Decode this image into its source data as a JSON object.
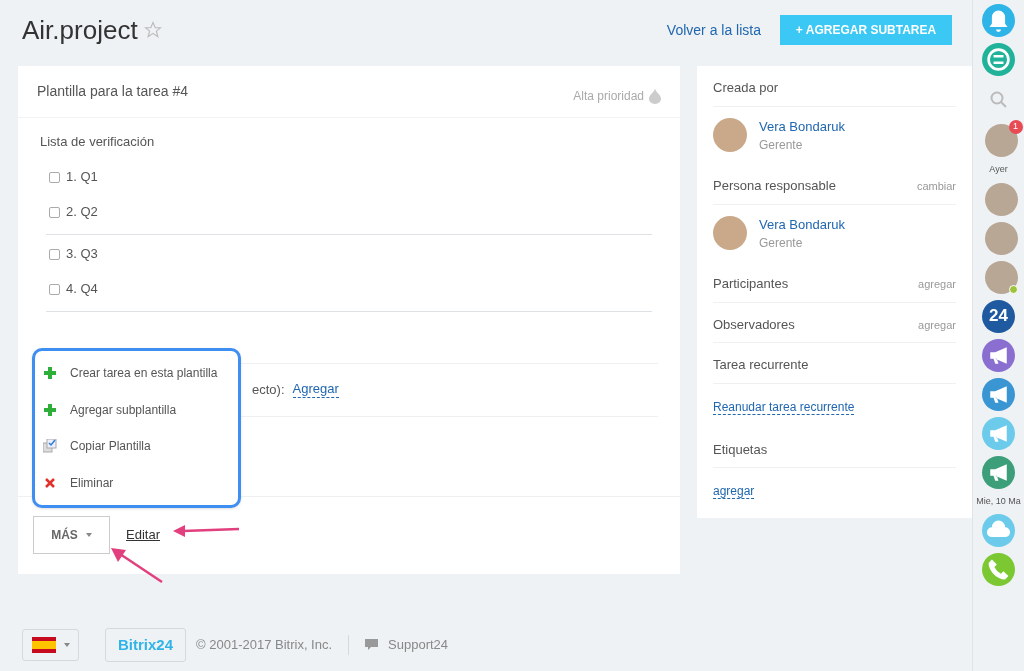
{
  "header": {
    "title": "Air.project",
    "starred": false,
    "back_link": "Volver a la lista",
    "add_button": "+ AGREGAR SUBTAREA"
  },
  "task": {
    "title": "Plantilla para la tarea #4",
    "priority": "Alta prioridad",
    "checklist_title": "Lista de verificación",
    "groups": [
      [
        {
          "label": "1. Q1",
          "checked": false
        },
        {
          "label": "2. Q2",
          "checked": false
        }
      ],
      [
        {
          "label": "3. Q3",
          "checked": false
        },
        {
          "label": "4. Q4",
          "checked": false
        }
      ]
    ],
    "project_row": {
      "label": "ecto):",
      "link": "Agregar"
    },
    "more_button": "MÁS",
    "edit_link": "Editar"
  },
  "menu": [
    {
      "kind": "plus",
      "label": "Crear tarea en esta plantilla"
    },
    {
      "kind": "plus",
      "label": "Agregar subplantilla"
    },
    {
      "kind": "copy",
      "label": "Copiar Plantilla"
    },
    {
      "kind": "delete",
      "label": "Eliminar"
    }
  ],
  "side": {
    "created_by": "Creada por",
    "creator": {
      "name": "Vera Bondaruk",
      "role": "Gerente"
    },
    "responsible": "Persona responsable",
    "change": "cambiar",
    "responsible_person": {
      "name": "Vera Bondaruk",
      "role": "Gerente"
    },
    "participants": "Participantes",
    "participants_add": "agregar",
    "observers": "Observadores",
    "observers_add": "agregar",
    "recurring": "Tarea recurrente",
    "recurring_link": "Reanudar tarea recurrente",
    "tags": "Etiquetas",
    "tags_add": "agregar"
  },
  "rail": [
    {
      "kind": "bell",
      "color": "#2fb4e8"
    },
    {
      "kind": "chat",
      "color": "#21b39a"
    },
    {
      "kind": "search"
    },
    {
      "kind": "avatar",
      "badge": "1"
    },
    {
      "kind": "label",
      "text": "Ayer"
    },
    {
      "kind": "avatar"
    },
    {
      "kind": "avatar"
    },
    {
      "kind": "avatar",
      "online": true
    },
    {
      "kind": "b24",
      "text": "24",
      "color": "#1f5aa0"
    },
    {
      "kind": "megaphone",
      "color": "#8a6fd1"
    },
    {
      "kind": "megaphone",
      "color": "#3a96d3"
    },
    {
      "kind": "megaphone",
      "color": "#6ccbeb"
    },
    {
      "kind": "megaphone",
      "color": "#3c9f7a"
    },
    {
      "kind": "label",
      "text": "Mie, 10 Ma"
    },
    {
      "kind": "cloud",
      "color": "#6ccbeb"
    },
    {
      "kind": "phone",
      "color": "#7cc832"
    }
  ],
  "footer": {
    "brand": "Bitrix24",
    "copyright": "© 2001-2017 Bitrix, Inc.",
    "support": "Support24"
  }
}
